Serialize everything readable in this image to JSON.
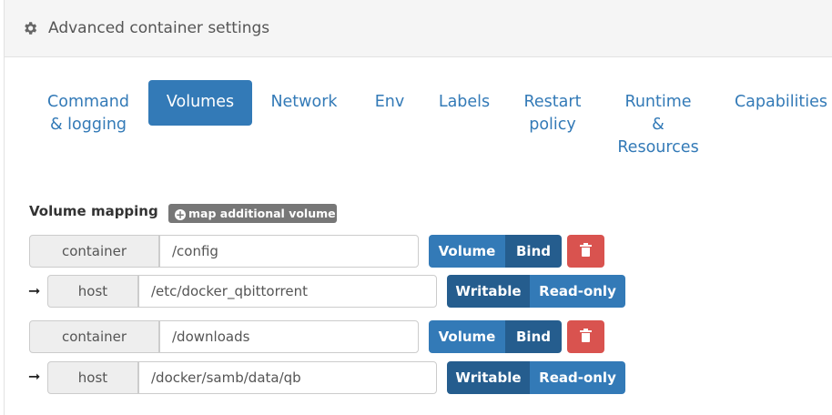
{
  "header": {
    "title": "Advanced container settings",
    "icon": "gear-icon"
  },
  "tabs": [
    {
      "label_lines": [
        "Command",
        "& logging"
      ],
      "active": false
    },
    {
      "label_lines": [
        "Volumes"
      ],
      "active": true
    },
    {
      "label_lines": [
        "Network"
      ],
      "active": false
    },
    {
      "label_lines": [
        "Env"
      ],
      "active": false
    },
    {
      "label_lines": [
        "Labels"
      ],
      "active": false
    },
    {
      "label_lines": [
        "Restart",
        "policy"
      ],
      "active": false
    },
    {
      "label_lines": [
        "Runtime",
        "&",
        "Resources"
      ],
      "active": false
    },
    {
      "label_lines": [
        "Capabilities"
      ],
      "active": false
    }
  ],
  "volumes": {
    "section_label": "Volume mapping",
    "add_button_label": "map additional volume",
    "container_label": "container",
    "host_label": "host",
    "volume_label": "Volume",
    "bind_label": "Bind",
    "writable_label": "Writable",
    "readonly_label": "Read-only",
    "mappings": [
      {
        "container": "/config",
        "host": "/etc/docker_qbittorrent",
        "type": "Bind",
        "mode": "Writable"
      },
      {
        "container": "/downloads",
        "host": "/docker/samb/data/qb",
        "type": "Bind",
        "mode": "Writable"
      }
    ]
  },
  "colors": {
    "primary": "#337ab7",
    "primary_active": "#255d8e",
    "danger": "#d9534f",
    "muted_button": "#777777"
  }
}
